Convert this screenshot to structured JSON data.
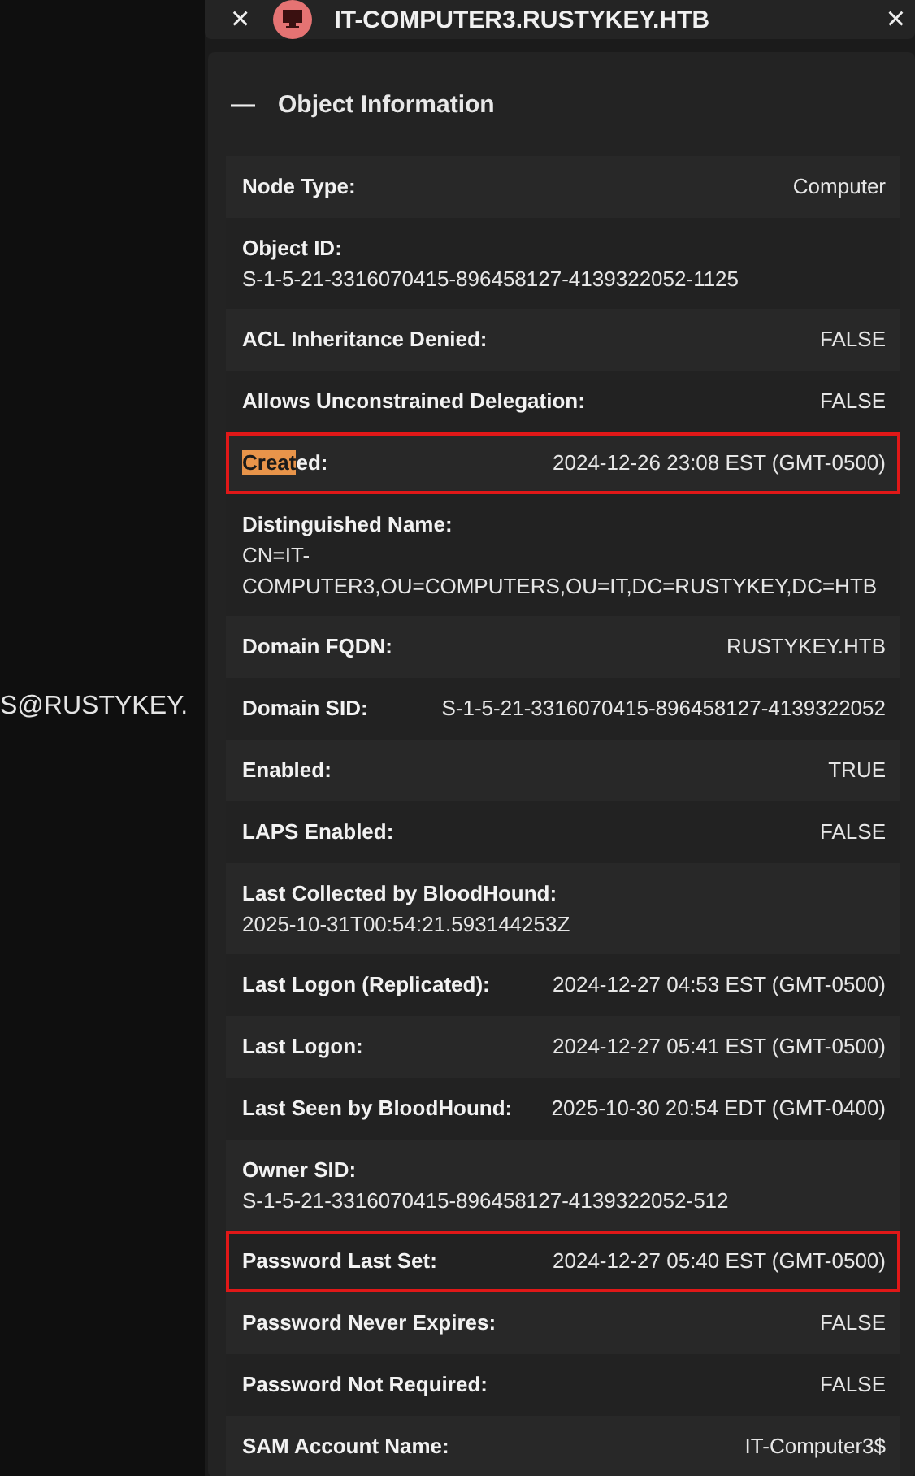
{
  "background_text": "S@RUSTYKEY.",
  "header": {
    "close": "×",
    "title": "IT-COMPUTER3.RUSTYKEY.HTB",
    "collapse": "×"
  },
  "section": {
    "toggle": "—",
    "title": "Object Information",
    "expanded": true,
    "rows": [
      {
        "kind": "inline",
        "label": "Node Type:",
        "value": "Computer",
        "highlighted": false
      },
      {
        "kind": "stacked",
        "label": "Object ID:",
        "value": "S-1-5-21-3316070415-896458127-4139322052-1125",
        "highlighted": false
      },
      {
        "kind": "inline",
        "label": "ACL Inheritance Denied:",
        "value": "FALSE",
        "highlighted": false
      },
      {
        "kind": "inline",
        "label": "Allows Unconstrained Delegation:",
        "value": "FALSE",
        "highlighted": false
      },
      {
        "kind": "inline",
        "label_match": "Creat",
        "label": "ed:",
        "value": "2024-12-26 23:08 EST (GMT-0500)",
        "highlighted": true
      },
      {
        "kind": "stacked",
        "label": "Distinguished Name:",
        "value": "CN=IT-COMPUTER3,OU=COMPUTERS,OU=IT,DC=RUSTYKEY,DC=HTB",
        "highlighted": false
      },
      {
        "kind": "inline",
        "label": "Domain FQDN:",
        "value": "RUSTYKEY.HTB",
        "highlighted": false
      },
      {
        "kind": "inline",
        "label": "Domain SID:",
        "value": "S-1-5-21-3316070415-896458127-4139322052",
        "highlighted": false
      },
      {
        "kind": "inline",
        "label": "Enabled:",
        "value": "TRUE",
        "highlighted": false
      },
      {
        "kind": "inline",
        "label": "LAPS Enabled:",
        "value": "FALSE",
        "highlighted": false
      },
      {
        "kind": "stacked",
        "label": "Last Collected by BloodHound:",
        "value": "2025-10-31T00:54:21.593144253Z",
        "highlighted": false
      },
      {
        "kind": "inline",
        "label": "Last Logon (Replicated):",
        "value": "2024-12-27 04:53 EST (GMT-0500)",
        "highlighted": false
      },
      {
        "kind": "inline",
        "label": "Last Logon:",
        "value": "2024-12-27 05:41 EST (GMT-0500)",
        "highlighted": false
      },
      {
        "kind": "inline",
        "label": "Last Seen by BloodHound:",
        "value": "2025-10-30 20:54 EDT (GMT-0400)",
        "highlighted": false
      },
      {
        "kind": "stacked",
        "label": "Owner SID:",
        "value": "S-1-5-21-3316070415-896458127-4139322052-512",
        "highlighted": false
      },
      {
        "kind": "inline",
        "label": "Password Last Set:",
        "value": "2024-12-27 05:40 EST (GMT-0500)",
        "highlighted": true
      },
      {
        "kind": "inline",
        "label": "Password Never Expires:",
        "value": "FALSE",
        "highlighted": false
      },
      {
        "kind": "inline",
        "label": "Password Not Required:",
        "value": "FALSE",
        "highlighted": false
      },
      {
        "kind": "inline",
        "label": "SAM Account Name:",
        "value": "IT-Computer3$",
        "highlighted": false
      }
    ]
  }
}
